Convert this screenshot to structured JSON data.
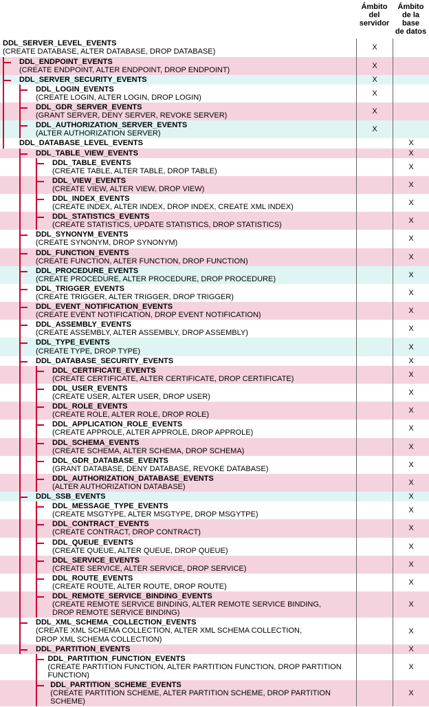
{
  "headers": {
    "col1_l1": "Ámbito",
    "col1_l2": "del",
    "col1_l3": "servidor",
    "col2_l1": "Ámbito",
    "col2_l2": "de la base",
    "col2_l3": "de datos"
  },
  "rows": [
    {
      "indent": 0,
      "corner": false,
      "vlines": [],
      "bg": "white",
      "title": "DDL_SERVER_LEVEL_EVENTS",
      "sub": "(CREATE DATABASE, ALTER DATABASE, DROP DATABASE)",
      "c1": "X",
      "c2": ""
    },
    {
      "indent": 1,
      "corner": true,
      "vlines": [
        0
      ],
      "bg": "pink",
      "title": "DDL_ENDPOINT_EVENTS",
      "sub": "(CREATE ENDPOINT, ALTER ENDPOINT, DROP ENDPOINT)",
      "c1": "X",
      "c2": ""
    },
    {
      "indent": 1,
      "corner": true,
      "vlines": [
        0
      ],
      "bg": "cyan",
      "title": "DDL_SERVER_SECURITY_EVENTS",
      "sub": "",
      "c1": "X",
      "c2": ""
    },
    {
      "indent": 2,
      "corner": true,
      "vlines": [
        0,
        1
      ],
      "bg": "white",
      "title": "DDL_LOGIN_EVENTS",
      "sub": "(CREATE LOGIN, ALTER LOGIN, DROP LOGIN)",
      "c1": "X",
      "c2": ""
    },
    {
      "indent": 2,
      "corner": true,
      "vlines": [
        0,
        1
      ],
      "bg": "pink",
      "title": "DDL_GDR_SERVER_EVENTS",
      "sub": "(GRANT SERVER, DENY SERVER, REVOKE SERVER)",
      "c1": "X",
      "c2": ""
    },
    {
      "indent": 2,
      "corner": true,
      "vlines": [
        0,
        1
      ],
      "bg": "cyan",
      "title": "DDL_AUTHORIZATION_SERVER_EVENTS",
      "sub": "(ALTER AUTHORIZATION SERVER)",
      "c1": "X",
      "c2": ""
    },
    {
      "indent": 1,
      "corner": false,
      "vlines": [
        0
      ],
      "bg": "white",
      "title": "DDL_DATABASE_LEVEL_EVENTS",
      "sub": "",
      "c1": "",
      "c2": "X"
    },
    {
      "indent": 2,
      "corner": true,
      "vlines": [
        1
      ],
      "bg": "pink",
      "title": "DDL_TABLE_VIEW_EVENTS",
      "sub": "",
      "c1": "",
      "c2": "X"
    },
    {
      "indent": 3,
      "corner": true,
      "vlines": [
        1,
        2
      ],
      "bg": "white",
      "title": "DDL_TABLE_EVENTS",
      "sub": "(CREATE TABLE, ALTER TABLE, DROP TABLE)",
      "c1": "",
      "c2": "X"
    },
    {
      "indent": 3,
      "corner": true,
      "vlines": [
        1,
        2
      ],
      "bg": "pink",
      "title": "DDL_VIEW_EVENTS",
      "sub": "(CREATE VIEW, ALTER VIEW, DROP VIEW)",
      "c1": "",
      "c2": "X"
    },
    {
      "indent": 3,
      "corner": true,
      "vlines": [
        1,
        2
      ],
      "bg": "white",
      "title": "DDL_INDEX_EVENTS",
      "sub": "(CREATE INDEX, ALTER INDEX, DROP INDEX, CREATE XML INDEX)",
      "c1": "",
      "c2": "X"
    },
    {
      "indent": 3,
      "corner": true,
      "vlines": [
        1,
        2
      ],
      "bg": "pink",
      "title": "DDL_STATISTICS_EVENTS",
      "sub": "(CREATE STATISTICS, UPDATE STATISTICS, DROP STATISTICS)",
      "c1": "",
      "c2": "X"
    },
    {
      "indent": 2,
      "corner": true,
      "vlines": [
        1
      ],
      "bg": "white",
      "title": "DDL_SYNONYM_EVENTS",
      "sub": "(CREATE SYNONYM, DROP SYNONYM)",
      "c1": "",
      "c2": "X"
    },
    {
      "indent": 2,
      "corner": true,
      "vlines": [
        1
      ],
      "bg": "pink",
      "title": "DDL_FUNCTION_EVENTS",
      "sub": "(CREATE FUNCTION, ALTER FUNCTION, DROP FUNCTION)",
      "c1": "",
      "c2": "X"
    },
    {
      "indent": 2,
      "corner": true,
      "vlines": [
        1
      ],
      "bg": "cyan",
      "title": "DDL_PROCEDURE_EVENTS",
      "sub": "(CREATE PROCEDURE, ALTER PROCEDURE, DROP PROCEDURE)",
      "c1": "",
      "c2": "X"
    },
    {
      "indent": 2,
      "corner": true,
      "vlines": [
        1
      ],
      "bg": "white",
      "title": "DDL_TRIGGER_EVENTS",
      "sub": "(CREATE TRIGGER, ALTER TRIGGER, DROP TRIGGER)",
      "c1": "",
      "c2": "X"
    },
    {
      "indent": 2,
      "corner": true,
      "vlines": [
        1
      ],
      "bg": "pink",
      "title": "DDL_EVENT_NOTIFICATION_EVENTS",
      "sub": "(CREATE EVENT NOTIFICATION, DROP EVENT NOTIFICATION)",
      "c1": "",
      "c2": "X"
    },
    {
      "indent": 2,
      "corner": true,
      "vlines": [
        1
      ],
      "bg": "white",
      "title": "DDL_ASSEMBLY_EVENTS",
      "sub": "(CREATE ASSEMBLY, ALTER ASSEMBLY, DROP ASSEMBLY)",
      "c1": "",
      "c2": "X"
    },
    {
      "indent": 2,
      "corner": true,
      "vlines": [
        1
      ],
      "bg": "cyan",
      "title": "DDL_TYPE_EVENTS",
      "sub": "(CREATE TYPE, DROP TYPE)",
      "c1": "",
      "c2": "X"
    },
    {
      "indent": 2,
      "corner": true,
      "vlines": [
        1
      ],
      "bg": "white",
      "title": "DDL_DATABASE_SECURITY_EVENTS",
      "sub": "",
      "c1": "",
      "c2": "X"
    },
    {
      "indent": 3,
      "corner": true,
      "vlines": [
        1,
        2
      ],
      "bg": "pink",
      "title": "DDL_CERTIFICATE_EVENTS",
      "sub": "(CREATE CERTIFICATE, ALTER CERTIFICATE, DROP CERTIFICATE)",
      "c1": "",
      "c2": "X"
    },
    {
      "indent": 3,
      "corner": true,
      "vlines": [
        1,
        2
      ],
      "bg": "white",
      "title": "DDL_USER_EVENTS",
      "sub": "(CREATE USER, ALTER USER, DROP USER)",
      "c1": "",
      "c2": "X"
    },
    {
      "indent": 3,
      "corner": true,
      "vlines": [
        1,
        2
      ],
      "bg": "pink",
      "title": "DDL_ROLE_EVENTS",
      "sub": "(CREATE ROLE, ALTER ROLE, DROP ROLE)",
      "c1": "",
      "c2": "X"
    },
    {
      "indent": 3,
      "corner": true,
      "vlines": [
        1,
        2
      ],
      "bg": "white",
      "title": "DDL_APPLICATION_ROLE_EVENTS",
      "sub": "(CREATE APPROLE, ALTER APPROLE, DROP APPROLE)",
      "c1": "",
      "c2": "X"
    },
    {
      "indent": 3,
      "corner": true,
      "vlines": [
        1,
        2
      ],
      "bg": "pink",
      "title": "DDL_SCHEMA_EVENTS",
      "sub": "(CREATE SCHEMA, ALTER SCHEMA, DROP SCHEMA)",
      "c1": "",
      "c2": "X"
    },
    {
      "indent": 3,
      "corner": true,
      "vlines": [
        1,
        2
      ],
      "bg": "white",
      "title": "DDL_GDR_DATABASE_EVENTS",
      "sub": "(GRANT DATABASE, DENY DATABASE, REVOKE DATABASE)",
      "c1": "",
      "c2": "X"
    },
    {
      "indent": 3,
      "corner": true,
      "vlines": [
        1,
        2
      ],
      "bg": "pink",
      "title": "DDL_AUTHORIZATION_DATABASE_EVENTS",
      "sub": "(ALTER AUTHORIZATION DATABASE)",
      "c1": "",
      "c2": "X"
    },
    {
      "indent": 2,
      "corner": true,
      "vlines": [
        1
      ],
      "bg": "cyan",
      "title": "DDL_SSB_EVENTS",
      "sub": "",
      "c1": "",
      "c2": "X"
    },
    {
      "indent": 3,
      "corner": true,
      "vlines": [
        1,
        2
      ],
      "bg": "white",
      "title": "DDL_MESSAGE_TYPE_EVENTS",
      "sub": "(CREATE MSGTYPE, ALTER MSGTYPE, DROP MSGYTPE)",
      "c1": "",
      "c2": "X"
    },
    {
      "indent": 3,
      "corner": true,
      "vlines": [
        1,
        2
      ],
      "bg": "pink",
      "title": "DDL_CONTRACT_EVENTS",
      "sub": "(CREATE CONTRACT, DROP CONTRACT)",
      "c1": "",
      "c2": "X"
    },
    {
      "indent": 3,
      "corner": true,
      "vlines": [
        1,
        2
      ],
      "bg": "white",
      "title": "DDL_QUEUE_EVENTS",
      "sub": "(CREATE QUEUE, ALTER QUEUE, DROP QUEUE)",
      "c1": "",
      "c2": "X"
    },
    {
      "indent": 3,
      "corner": true,
      "vlines": [
        1,
        2
      ],
      "bg": "pink",
      "title": "DDL_SERVICE_EVENTS",
      "sub": "(CREATE SERVICE, ALTER SERVICE, DROP SERVICE)",
      "c1": "",
      "c2": "X"
    },
    {
      "indent": 3,
      "corner": true,
      "vlines": [
        1,
        2
      ],
      "bg": "white",
      "title": "DDL_ROUTE_EVENTS",
      "sub": "(CREATE ROUTE, ALTER ROUTE, DROP ROUTE)",
      "c1": "",
      "c2": "X"
    },
    {
      "indent": 3,
      "corner": true,
      "vlines": [
        1,
        2
      ],
      "bg": "pink",
      "title": "DDL_REMOTE_SERVICE_BINDING_EVENTS",
      "sub": "(CREATE REMOTE SERVICE BINDING, ALTER REMOTE SERVICE BINDING,\n DROP REMOTE SERVICE BINDING)",
      "c1": "",
      "c2": "X"
    },
    {
      "indent": 2,
      "corner": true,
      "vlines": [
        1
      ],
      "bg": "white",
      "title": "DDL_XML_SCHEMA_COLLECTION_EVENTS",
      "sub": "(CREATE XML SCHEMA COLLECTION, ALTER XML SCHEMA COLLECTION,\n DROP XML SCHEMA COLLECTION)",
      "c1": "",
      "c2": "X"
    },
    {
      "indent": 2,
      "corner": true,
      "vlines": [
        1
      ],
      "bg": "pink",
      "title": "DDL_PARTITION_EVENTS",
      "sub": "",
      "c1": "",
      "c2": "X"
    },
    {
      "indent": 3,
      "corner": true,
      "vlines": [
        2
      ],
      "bg": "white",
      "title": "DDL_PARTITION_FUNCTION_EVENTS",
      "sub": "(CREATE PARTITION FUNCTION, ALTER PARTITION FUNCTION, DROP PARTITION FUNCTION)",
      "c1": "",
      "c2": "X"
    },
    {
      "indent": 3,
      "corner": true,
      "vlines": [
        2
      ],
      "bg": "pink",
      "title": "DDL_PARTITION_SCHEME_EVENTS",
      "sub": "(CREATE PARTITION SCHEME, ALTER PARTITION SCHEME, DROP PARTITION SCHEME)",
      "c1": "",
      "c2": "X"
    }
  ]
}
